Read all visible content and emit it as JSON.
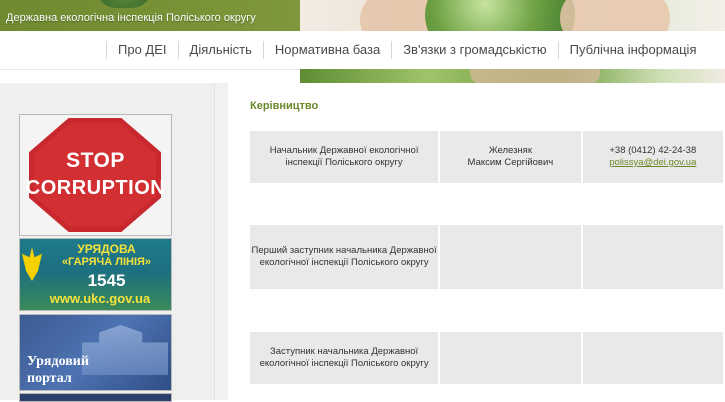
{
  "header": {
    "title": "Державна екологічна інспекція Поліського округу"
  },
  "nav": {
    "items": [
      {
        "label": "Про ДЕІ"
      },
      {
        "label": "Діяльність"
      },
      {
        "label": "Нормативна база"
      },
      {
        "label": "Зв'язки з громадськістю"
      },
      {
        "label": "Публічна інформація"
      }
    ]
  },
  "sidebar": {
    "banners": {
      "stop": {
        "line1": "STOP",
        "line2": "CORRUPTION"
      },
      "hotline": {
        "line1": "УРЯДОВА",
        "line2": "«ГАРЯЧА ЛІНІЯ»",
        "number": "1545",
        "url": "www.ukc.gov.ua"
      },
      "portal": {
        "line1": "Урядовий",
        "line2": "портал"
      }
    }
  },
  "main": {
    "section_title": "Керівництво",
    "rows": [
      {
        "position": "Начальник Державної екологічної інспекції Поліського округу",
        "name_line1": "Железняк",
        "name_line2": "Максим Сергійович",
        "phone": "+38 (0412) 42-24-38",
        "email": "polissya@dei.gov.ua"
      },
      {
        "position": "Перший заступник начальника Державної екологічної інспекції Поліського округу",
        "name_line1": "",
        "name_line2": "",
        "phone": "",
        "email": ""
      },
      {
        "position": "Заступник начальника Державної екологічної інспекції Поліського округу",
        "name_line1": "",
        "name_line2": "",
        "phone": "",
        "email": ""
      }
    ]
  },
  "colors": {
    "header_green": "#7d973a",
    "accent_green": "#6a8a2a",
    "stop_red": "#c8282d",
    "cell_bg": "#e9e9e9"
  }
}
